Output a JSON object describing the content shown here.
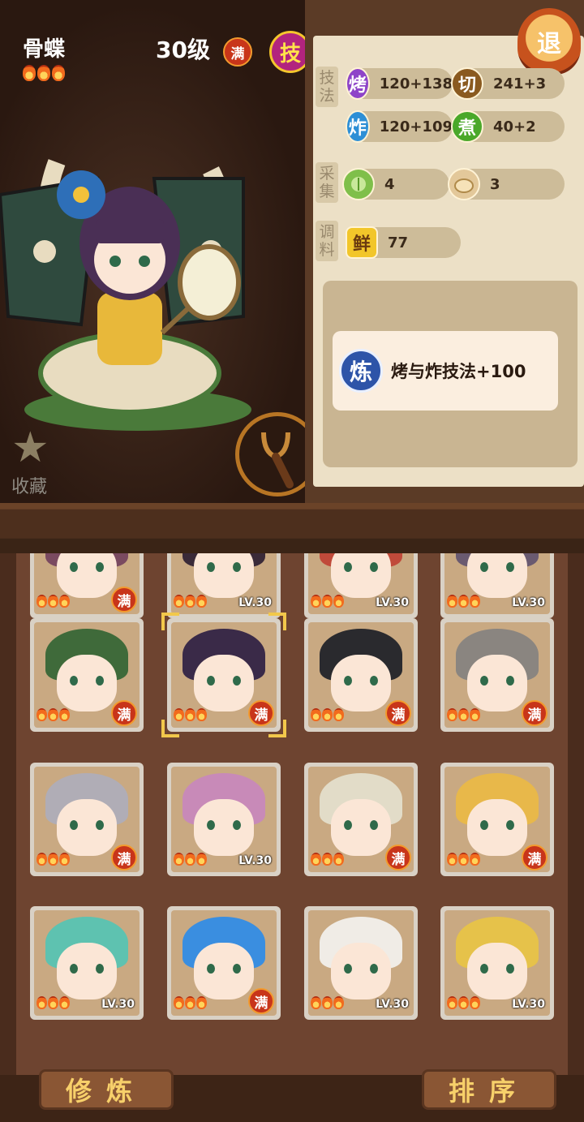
{
  "character": {
    "name": "骨蝶",
    "level": "30级",
    "max_badge": "满",
    "skill_badge": "技",
    "rarity": 3,
    "favorite_label": "收藏"
  },
  "skills": {
    "exit_label": "退",
    "technique_label": "技法",
    "gather_label": "采集",
    "seasoning_label": "调料",
    "technique": [
      {
        "icon": "烤",
        "value": "120+138",
        "color": "#8e44c8"
      },
      {
        "icon": "切",
        "value": "241+3",
        "color": "#8a5a20"
      },
      {
        "icon": "炸",
        "value": "120+109",
        "color": "#2d8fd6"
      },
      {
        "icon": "煮",
        "value": "40+2",
        "color": "#4aa82a"
      }
    ],
    "gather": [
      {
        "icon": "cabbage-icon",
        "value": "4"
      },
      {
        "icon": "bun-icon",
        "value": "3"
      }
    ],
    "seasoning": {
      "icon": "鲜",
      "value": "77"
    },
    "effect": {
      "icon": "炼",
      "text": "烤与炸技法+100"
    }
  },
  "roster": [
    {
      "badge": "max",
      "badge_text": "满",
      "lv": "",
      "hair": "#7a4a60"
    },
    {
      "badge": "lv",
      "badge_text": "",
      "lv": "LV.30",
      "hair": "#3a2a38"
    },
    {
      "badge": "lv",
      "badge_text": "",
      "lv": "LV.30",
      "hair": "#c04a3a"
    },
    {
      "badge": "lv",
      "badge_text": "",
      "lv": "LV.30",
      "hair": "#6a5a70"
    },
    {
      "badge": "max",
      "badge_text": "满",
      "lv": "",
      "hair": "#3f6a3a"
    },
    {
      "badge": "max",
      "badge_text": "满",
      "lv": "",
      "hair": "#3a2a48"
    },
    {
      "badge": "max",
      "badge_text": "满",
      "lv": "",
      "hair": "#2a2a2e"
    },
    {
      "badge": "max",
      "badge_text": "满",
      "lv": "",
      "hair": "#8a8580"
    },
    {
      "badge": "max",
      "badge_text": "满",
      "lv": "",
      "hair": "#b0adb6"
    },
    {
      "badge": "lv",
      "badge_text": "",
      "lv": "LV.30",
      "hair": "#c88ab8"
    },
    {
      "badge": "max",
      "badge_text": "满",
      "lv": "",
      "hair": "#e2dcc8"
    },
    {
      "badge": "max",
      "badge_text": "满",
      "lv": "",
      "hair": "#e8b84a"
    },
    {
      "badge": "lv",
      "badge_text": "",
      "lv": "LV.30",
      "hair": "#5ec2b0"
    },
    {
      "badge": "max",
      "badge_text": "满",
      "lv": "",
      "hair": "#3a8ee0"
    },
    {
      "badge": "lv",
      "badge_text": "",
      "lv": "LV.30",
      "hair": "#f0ece6"
    },
    {
      "badge": "lv",
      "badge_text": "",
      "lv": "LV.30",
      "hair": "#e6c24a"
    }
  ],
  "bottom": {
    "cultivate_label": "修炼",
    "sort_label": "排序"
  }
}
